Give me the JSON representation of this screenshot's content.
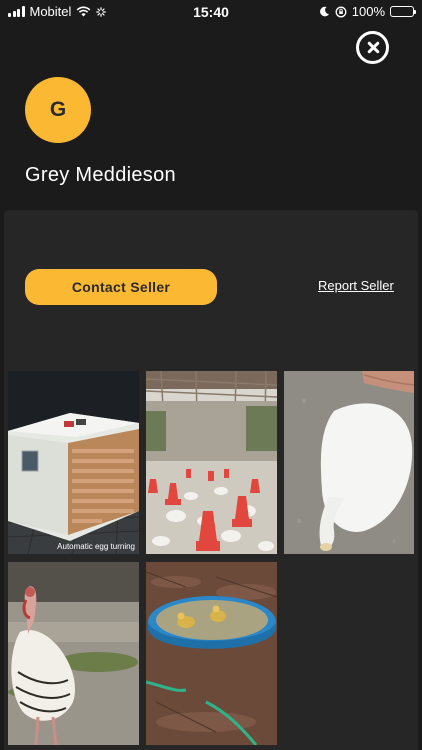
{
  "status_bar": {
    "carrier": "Mobitel",
    "time": "15:40",
    "battery": "100%",
    "icons": [
      "signal-icon",
      "wifi-icon",
      "loading-icon",
      "moon-icon",
      "orientation-lock-icon",
      "battery-icon"
    ]
  },
  "close": {
    "icon": "close-icon"
  },
  "profile": {
    "initial": "G",
    "name": "Grey Meddieson",
    "avatar_color": "#fbb933"
  },
  "actions": {
    "contact_label": "Contact Seller",
    "report_label": "Report Seller",
    "accent_color": "#fbb933"
  },
  "gallery": {
    "photos": [
      {
        "subject": "egg incubator",
        "caption": "Automatic egg turning"
      },
      {
        "subject": "poultry farm with red feeders",
        "caption": ""
      },
      {
        "subject": "white duck held by hand",
        "caption": ""
      },
      {
        "subject": "turkey on dirt ground",
        "caption": ""
      },
      {
        "subject": "ducklings in blue pool",
        "caption": ""
      }
    ]
  }
}
